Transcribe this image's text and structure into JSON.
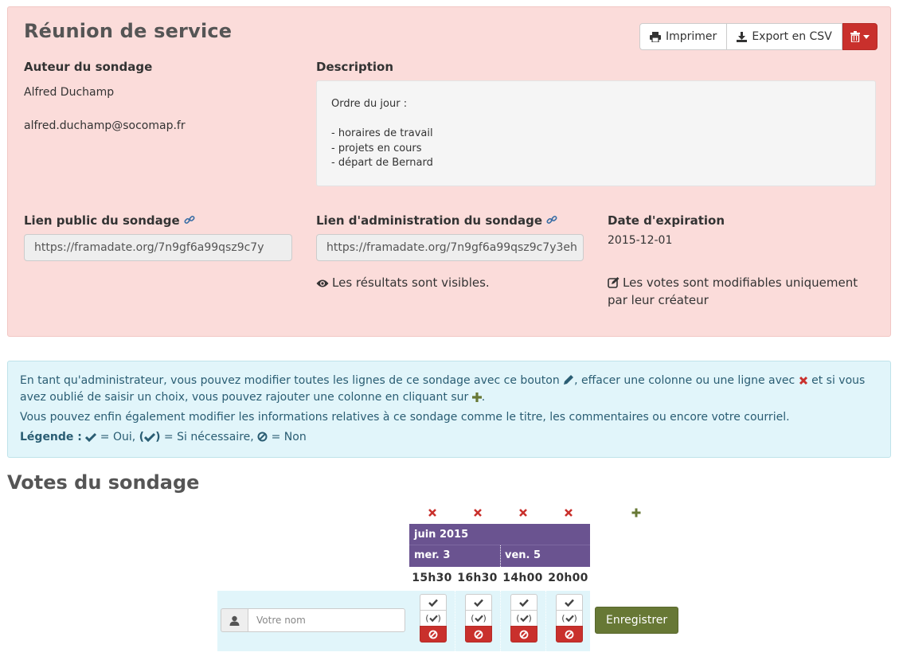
{
  "poll": {
    "title": "Réunion de service",
    "buttons": {
      "print": "Imprimer",
      "export_csv": "Export en CSV"
    },
    "author": {
      "label": "Auteur du sondage",
      "name": "Alfred Duchamp",
      "email": "alfred.duchamp@socomap.fr"
    },
    "description": {
      "label": "Description",
      "lines": [
        "Ordre du jour :",
        "",
        "- horaires de travail",
        "- projets en cours",
        "- départ de Bernard"
      ]
    },
    "public_link": {
      "label": "Lien public du sondage",
      "value": "https://framadate.org/7n9gf6a99qsz9c7y"
    },
    "admin_link": {
      "label": "Lien d'administration du sondage",
      "value": "https://framadate.org/7n9gf6a99qsz9c7y3eh"
    },
    "expiration": {
      "label": "Date d'expiration",
      "value": "2015-12-01"
    },
    "results_visible": "Les résultats sont visibles.",
    "votes_editable_line1": "Les votes sont modifiables uniquement",
    "votes_editable_line2": "par leur créateur"
  },
  "alert": {
    "p1_a": "En tant qu'administrateur, vous pouvez modifier toutes les lignes de ce sondage avec ce bouton ",
    "p1_b": ", effacer une colonne ou une ligne avec ",
    "p1_c": " et si vous avez oublié de saisir un choix, vous pouvez rajouter une colonne en cliquant sur ",
    "p1_d": ".",
    "p2": "Vous pouvez enfin également modifier les informations relatives à ce sondage comme le titre, les commentaires ou encore votre courriel.",
    "legend_label": "Légende :",
    "legend_yes": " = Oui, ",
    "legend_maybe_open": "(",
    "legend_maybe_close": ")",
    "legend_maybe": " = Si nécessaire, ",
    "legend_no": " = Non"
  },
  "votes": {
    "title": "Votes du sondage",
    "month": "juin 2015",
    "days": [
      "mer. 3",
      "ven. 5"
    ],
    "hours": [
      "15h30",
      "16h30",
      "14h00",
      "20h00"
    ],
    "maybe_open": "(",
    "maybe_close": ")",
    "name_placeholder": "Votre nom",
    "save": "Enregistrer"
  },
  "colors": {
    "panel": "#fbdcda",
    "alert": "#e1f5fa",
    "header": "#6a5390",
    "danger": "#c9302c",
    "save": "#677835"
  },
  "icons": [
    "print-icon",
    "download-icon",
    "trash-icon",
    "link-icon",
    "eye-icon",
    "edit-icon",
    "pencil-icon",
    "remove-icon",
    "plus-icon",
    "check-icon",
    "ban-icon",
    "user-icon"
  ]
}
